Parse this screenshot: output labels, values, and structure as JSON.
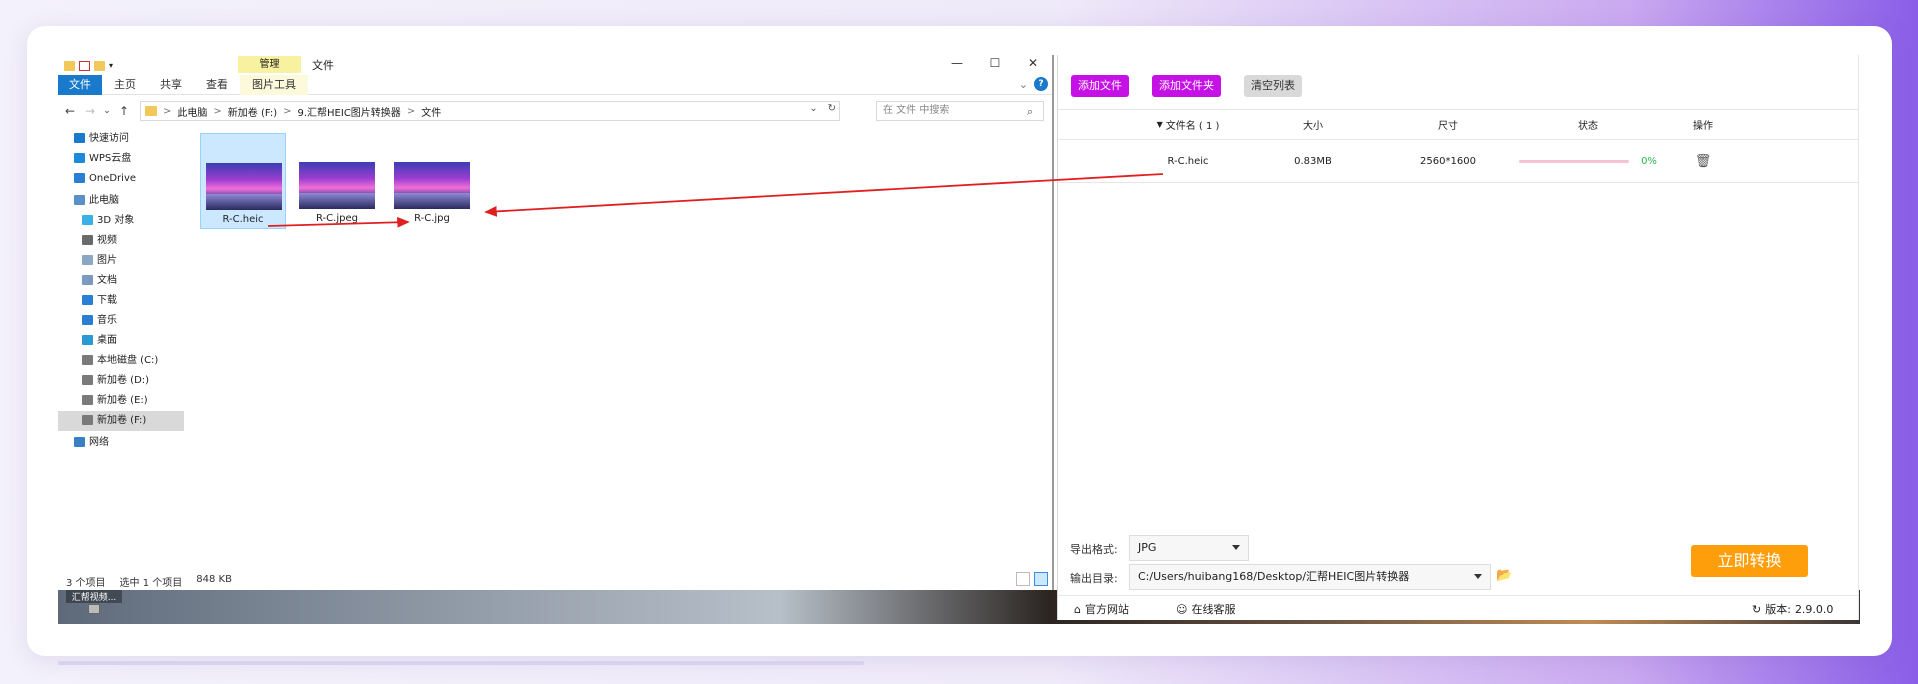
{
  "explorer": {
    "context_tab": "管理",
    "window_title": "文件",
    "window_controls": [
      "—",
      "☐",
      "✕"
    ],
    "ribbon_tabs": [
      "文件",
      "主页",
      "共享",
      "查看",
      "图片工具"
    ],
    "ribbon_collapse": "⌄",
    "nav_buttons": {
      "back": "←",
      "forward": "→",
      "recent": "⌄",
      "up": "↑"
    },
    "breadcrumb": [
      "此电脑",
      "新加卷 (F:)",
      "9.汇帮HEIC图片转换器",
      "文件"
    ],
    "breadcrumb_sep": ">",
    "refresh": "↻",
    "search_placeholder": "在 文件 中搜索",
    "nav_pane": [
      {
        "label": "快速访问",
        "indent": 1
      },
      {
        "label": "WPS云盘",
        "indent": 1
      },
      {
        "label": "OneDrive",
        "indent": 1
      },
      {
        "label": "此电脑",
        "indent": 1
      },
      {
        "label": "3D 对象",
        "indent": 2
      },
      {
        "label": "视频",
        "indent": 2
      },
      {
        "label": "图片",
        "indent": 2
      },
      {
        "label": "文档",
        "indent": 2
      },
      {
        "label": "下载",
        "indent": 2
      },
      {
        "label": "音乐",
        "indent": 2
      },
      {
        "label": "桌面",
        "indent": 2
      },
      {
        "label": "本地磁盘 (C:)",
        "indent": 2
      },
      {
        "label": "新加卷 (D:)",
        "indent": 2
      },
      {
        "label": "新加卷 (E:)",
        "indent": 2
      },
      {
        "label": "新加卷 (F:)",
        "indent": 2,
        "selected": true
      },
      {
        "label": "网络",
        "indent": 1
      }
    ],
    "files": [
      "R-C.heic",
      "R-C.jpeg",
      "R-C.jpg"
    ],
    "status": {
      "count": "3 个项目",
      "selected": "选中 1 个项目",
      "size": "848 KB"
    }
  },
  "converter": {
    "buttons": {
      "add_file": "添加文件",
      "add_folder": "添加文件夹",
      "clear_list": "清空列表"
    },
    "columns": {
      "name": "文件名 ( 1 )",
      "size": "大小",
      "dimensions": "尺寸",
      "status": "状态",
      "action": "操作"
    },
    "rows": [
      {
        "name": "R-C.heic",
        "size": "0.83MB",
        "dimensions": "2560*1600",
        "progress_pct": 0,
        "progress_label": "0%"
      }
    ],
    "format_label": "导出格式:",
    "format_value": "JPG",
    "output_label": "输出目录:",
    "output_value": "C:/Users/huibang168/Desktop/汇帮HEIC图片转换器",
    "convert_button": "立即转换",
    "official_site": "官方网站",
    "online_service": "在线客服",
    "version_label": "版本:",
    "version_value": "2.9.0.0"
  },
  "desktop": {
    "icon_label": "汇帮视频..."
  },
  "colors": {
    "purple_button": "#c510e6",
    "orange_button": "#ff9e0b",
    "progress_track": "#f7c3d3",
    "progress_text": "#2db34a",
    "arrow": "#e02020"
  }
}
